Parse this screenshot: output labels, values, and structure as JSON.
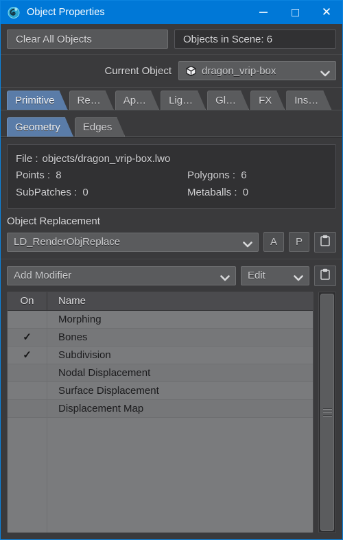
{
  "window": {
    "title": "Object Properties",
    "app_icon": "lightwave-swirl-icon",
    "accent_color": "#0078d7",
    "border_color": "#0b84e0",
    "panel_bg": "#3a3a3c",
    "controls": {
      "minimize": "minimize-icon",
      "maximize": "maximize-icon",
      "close": "close-icon"
    }
  },
  "toolbar": {
    "clear_all_label": "Clear All Objects",
    "objects_in_scene": "Objects in Scene: 6"
  },
  "current_object": {
    "label": "Current Object",
    "value": "dragon_vrip-box",
    "icon": "cube-icon"
  },
  "tabs": {
    "active_index": 0,
    "items": [
      {
        "label": "Primitive"
      },
      {
        "label": "Re…"
      },
      {
        "label": "Ap…"
      },
      {
        "label": "Lig…"
      },
      {
        "label": "Gl…"
      },
      {
        "label": "FX"
      },
      {
        "label": "Ins…"
      }
    ]
  },
  "subtabs": {
    "active_index": 0,
    "items": [
      {
        "label": "Geometry"
      },
      {
        "label": "Edges"
      }
    ]
  },
  "info": {
    "file_label": "File :",
    "file_value": "objects/dragon_vrip-box.lwo",
    "points_label": "Points :",
    "points_value": "8",
    "polygons_label": "Polygons :",
    "polygons_value": "6",
    "subpatches_label": "SubPatches :",
    "subpatches_value": "0",
    "metaballs_label": "Metaballs :",
    "metaballs_value": "0"
  },
  "object_replacement": {
    "section_title": "Object Replacement",
    "selected": "LD_RenderObjReplace",
    "btn_a": "A",
    "btn_p": "P",
    "clipboard_icon": "clipboard-icon"
  },
  "modifier_bar": {
    "add_modifier": "Add Modifier",
    "edit": "Edit",
    "clipboard_icon": "clipboard-icon"
  },
  "modifier_list": {
    "columns": [
      "On",
      "Name"
    ],
    "rows": [
      {
        "on": "",
        "name": "Morphing"
      },
      {
        "on": "✓",
        "name": "Bones"
      },
      {
        "on": "✓",
        "name": "Subdivision"
      },
      {
        "on": "",
        "name": "Nodal Displacement"
      },
      {
        "on": "",
        "name": "Surface Displacement"
      },
      {
        "on": "",
        "name": "Displacement Map"
      }
    ]
  }
}
